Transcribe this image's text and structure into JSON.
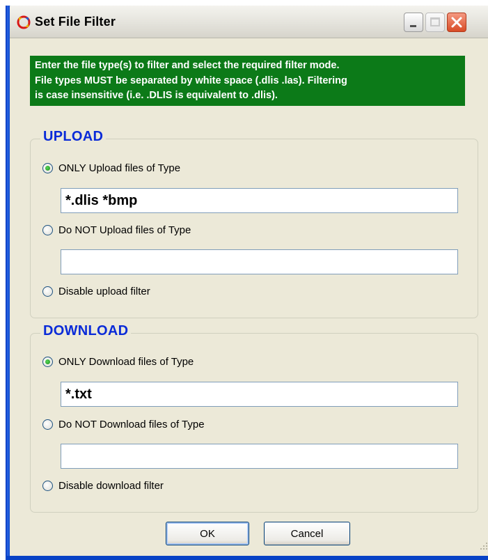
{
  "window": {
    "title": "Set File Filter"
  },
  "info_banner": {
    "lines": [
      "Enter the file type(s) to filter and select the required filter mode.",
      "File types MUST be separated by white space (.dlis .las). Filtering",
      "is case insensitive (i.e. .DLIS is equivalent to .dlis)."
    ],
    "background": "#0c7a18"
  },
  "upload": {
    "title": "UPLOAD",
    "options": [
      {
        "label": "ONLY Upload files of Type",
        "selected": true
      },
      {
        "label": "Do NOT Upload files of Type",
        "selected": false
      },
      {
        "label": "Disable upload filter",
        "selected": false
      }
    ],
    "only_value": "*.dlis *bmp",
    "not_value": ""
  },
  "download": {
    "title": "DOWNLOAD",
    "options": [
      {
        "label": "ONLY Download files of Type",
        "selected": true
      },
      {
        "label": "Do NOT Download files of Type",
        "selected": false
      },
      {
        "label": "Disable download filter",
        "selected": false
      }
    ],
    "only_value": "*.txt",
    "not_value": ""
  },
  "buttons": {
    "ok": "OK",
    "cancel": "Cancel"
  },
  "icons": {
    "app": "filter-app-icon",
    "minimize": "minimize-icon",
    "maximize": "maximize-icon",
    "close": "close-icon",
    "resize": "resize-grip-icon"
  },
  "colors": {
    "group_title": "#0a2bd8",
    "window_frame": "#0a46c8",
    "dialog_bg": "#ece9d8"
  }
}
